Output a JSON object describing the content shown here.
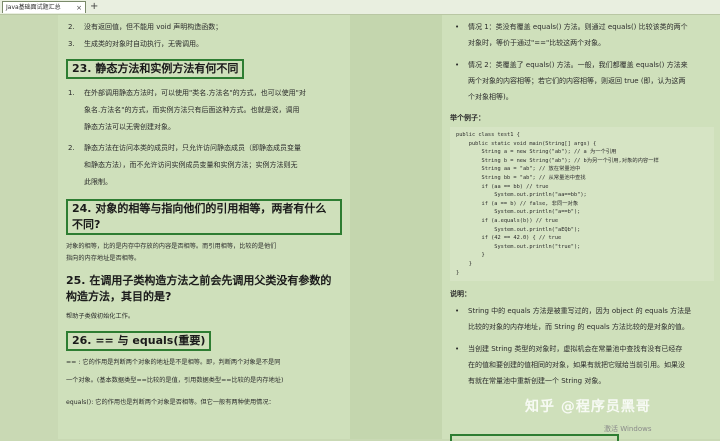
{
  "tab": {
    "title": "Java基础面试题汇总",
    "close": "×",
    "add": "+"
  },
  "left": {
    "top_items": [
      {
        "num": "2.",
        "text": "没有返回值，但不能用 void 声明构造函数；"
      },
      {
        "num": "3.",
        "text": "生成类的对象时自动执行，无需调用。"
      }
    ],
    "h23": "23. 静态方法和实例方法有何不同",
    "items23": [
      {
        "num": "1.",
        "line1": "在外部调用静态方法时，可以使用\"类名.方法名\"的方式，也可以使用\"对",
        "line2": "象名.方法名\"的方式，而实例方法只有后面这种方式。也就是说，调用",
        "line3": "静态方法可以无需创建对象。"
      },
      {
        "num": "2.",
        "line1": "静态方法在访问本类的成员时，只允许访问静态成员（即静态成员变量",
        "line2": "和静态方法），而不允许访问实例成员变量和实例方法；实例方法则无",
        "line3": "此限制。"
      }
    ],
    "h24": "24. 对象的相等与指向他们的引用相等，两者有什么不同?",
    "p24_1": "对象的相等，比的是内存中存放的内容是否相等。而引用相等，比较的是他们",
    "p24_2": "指向的内存地址是否相等。",
    "h25": "25. 在调用子类构造方法之前会先调用父类没有参数的构造方法，其目的是?",
    "p25": "帮助子类做初始化工作。",
    "h26": "26. == 与 equals(重要)",
    "p26_1": "== : 它的作用是判断两个对象的地址是不是相等。即，判断两个对象是不是同",
    "p26_2": "一个对象。(基本数据类型==比较的是值，引用数据类型==比较的是内存地址)",
    "p26_3": "equals(): 它的作用也是判断两个对象是否相等。但它一般有两种使用情况："
  },
  "right": {
    "case1_1": "情况 1：类没有覆盖 equals() 方法。则通过 equals() 比较该类的两个",
    "case1_2": "对象时，等价于通过\"==\"比较这两个对象。",
    "case2_1": "情况 2：类覆盖了 equals() 方法。一般，我们都覆盖 equals() 方法来",
    "case2_2": "两个对象的内容相等；若它们的内容相等，则返回 true (即，认为这两",
    "case2_3": "个对象相等)。",
    "example_label": "举个例子：",
    "code": [
      "public class test1 {",
      "    public static void main(String[] args) {",
      "        String a = new String(\"ab\"); // a 为一个引用",
      "        String b = new String(\"ab\"); // b为另一个引用,对象的内容一样",
      "        String aa = \"ab\"; // 放在常量池中",
      "        String bb = \"ab\"; // 从常量池中查找",
      "        if (aa == bb) // true",
      "            System.out.println(\"aa==bb\");",
      "        if (a == b) // false, 非同一对象",
      "            System.out.println(\"a==b\");",
      "        if (a.equals(b)) // true",
      "            System.out.println(\"aEQb\");",
      "        if (42 == 42.0) { // true",
      "            System.out.println(\"true\");",
      "        }",
      "    }",
      "}"
    ],
    "note_label": "说明：",
    "note1_1": "String 中的 equals 方法是被重写过的，因为 object 的 equals 方法是",
    "note1_2": "比较的对象的内存地址，而 String 的 equals 方法比较的是对象的值。",
    "note2_1": "当创建 String 类型的对象时，虚拟机会在常量池中查找有没有已经存",
    "note2_2": "在的值和要创建的值相同的对象，如果有就把它赋给当前引用。如果没",
    "note2_3": "有就在常量池中重新创建一个 String 对象。"
  },
  "watermark": "知乎 @程序员黑哥",
  "activate": "激活 Windows"
}
